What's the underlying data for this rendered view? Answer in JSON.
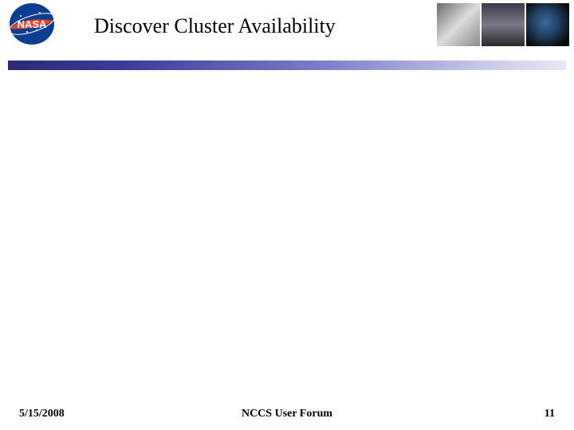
{
  "header": {
    "title": "Discover Cluster Availability",
    "logo_label": "NASA",
    "thumbs": [
      "cloud-swirl",
      "satellite-telescope",
      "earth-globe"
    ]
  },
  "divider": {
    "gradient_start": "#2a2a7a",
    "gradient_end": "#e8e8f4"
  },
  "footer": {
    "date": "5/15/2008",
    "center": "NCCS User Forum",
    "page": "11"
  }
}
